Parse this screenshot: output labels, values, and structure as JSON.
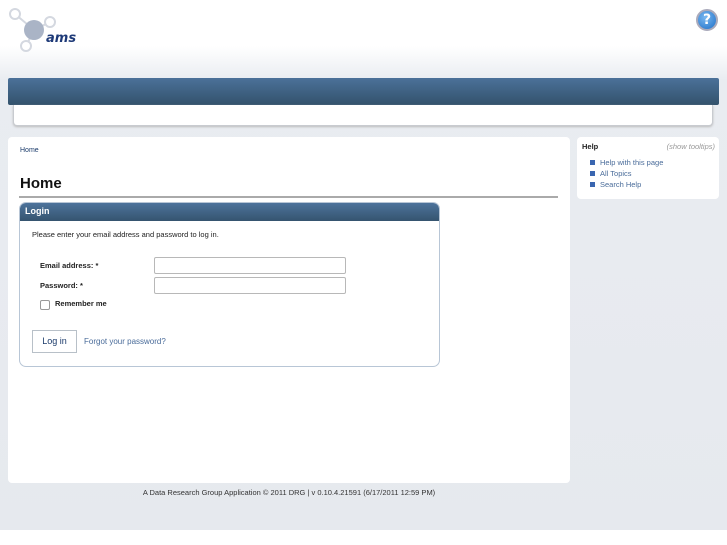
{
  "header": {
    "logo_text": "AMS",
    "help_icon": "question-mark-circle-icon"
  },
  "breadcrumb": [
    "Home"
  ],
  "page_title": "Home",
  "login": {
    "title": "Login",
    "instructions": "Please enter your email address and password to log in.",
    "email_label": "Email address: *",
    "email_value": "",
    "password_label": "Password: *",
    "password_value": "",
    "remember_label": "Remember me",
    "login_button": "Log in",
    "forgot_link": "Forgot your password?"
  },
  "help": {
    "title": "Help",
    "show_tooltips": "(show tooltips)",
    "items": [
      "Help with this page",
      "All Topics",
      "Search Help"
    ]
  },
  "footer": "A Data Research Group Application © 2011 DRG | v 0.10.4.21591 (6/17/2011 12:59 PM)",
  "colors": {
    "nav": "#4b7199",
    "link": "#4a6c9a"
  }
}
